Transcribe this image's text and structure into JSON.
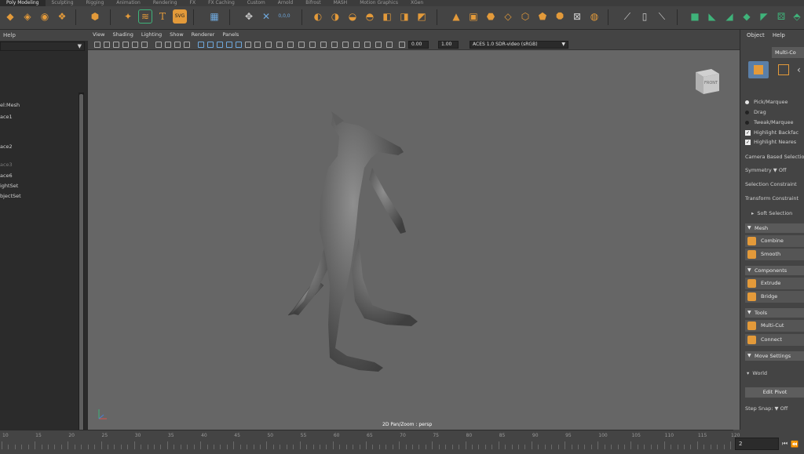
{
  "menu_tabs": [
    "Poly Modeling",
    "Sculpting",
    "Rigging",
    "Animation",
    "Rendering",
    "FX",
    "FX Caching",
    "Custom",
    "Arnold",
    "Bifrost",
    "MASH",
    "Motion Graphics",
    "XGen"
  ],
  "active_tab": "Poly Modeling",
  "shelf": {
    "svg_label": "SVG",
    "coord_label": "0,0,0"
  },
  "outliner": {
    "menu_label": "Help",
    "items": [
      {
        "label": "el:Mesh",
        "dim": false
      },
      {
        "label": "ace1",
        "dim": false
      },
      {
        "label": "ace2",
        "dim": false
      },
      {
        "label": "ace3",
        "dim": true
      },
      {
        "label": "ace6",
        "dim": false
      },
      {
        "label": "ightSet",
        "dim": false
      },
      {
        "label": "bjectSet",
        "dim": false
      }
    ]
  },
  "viewport": {
    "menus": [
      "View",
      "Shading",
      "Lighting",
      "Show",
      "Renderer",
      "Panels"
    ],
    "exposure": "0.00",
    "gamma": "1.00",
    "color_space": "ACES 1.0 SDR-video (sRGB)",
    "view_cube_label": "FRONT",
    "status_label": "2D Pan/Zoom : persp"
  },
  "right_panel": {
    "menus": [
      "Object",
      "Help"
    ],
    "tab_label": "Multi-Co",
    "pick_options": [
      {
        "label": "Pick/Marquee",
        "on": true
      },
      {
        "label": "Drag",
        "on": false
      },
      {
        "label": "Tweak/Marquee",
        "on": false
      }
    ],
    "checks": [
      "Highlight Backfac",
      "Highlight Neares"
    ],
    "camera_based": "Camera Based Selection",
    "symmetry_label": "Symmetry",
    "symmetry_value": "Off",
    "selection_constraint": "Selection Constraint",
    "transform_constraint": "Transform Constraint",
    "soft_selection": "Soft Selection",
    "sections": {
      "mesh": "Mesh",
      "components": "Components",
      "tools": "Tools",
      "move_settings": "Move Settings"
    },
    "tools": {
      "combine": "Combine",
      "smooth": "Smooth",
      "extrude": "Extrude",
      "bridge": "Bridge",
      "multicut": "Multi-Cut",
      "connect": "Connect"
    },
    "world_label": "World",
    "edit_pivot": "Edit Pivot",
    "step_snap_label": "Step Snap:",
    "step_snap_value": "Off"
  },
  "timeline": {
    "ticks": [
      "10",
      "15",
      "20",
      "25",
      "30",
      "35",
      "40",
      "45",
      "50",
      "55",
      "60",
      "65",
      "70",
      "75",
      "80",
      "85",
      "90",
      "95",
      "100",
      "105",
      "110",
      "115",
      "120"
    ],
    "current_frame": "2"
  },
  "colors": {
    "accent_orange": "#e39a3a",
    "shelf_green": "#3fb37a",
    "viewport_bg": "#666666"
  }
}
